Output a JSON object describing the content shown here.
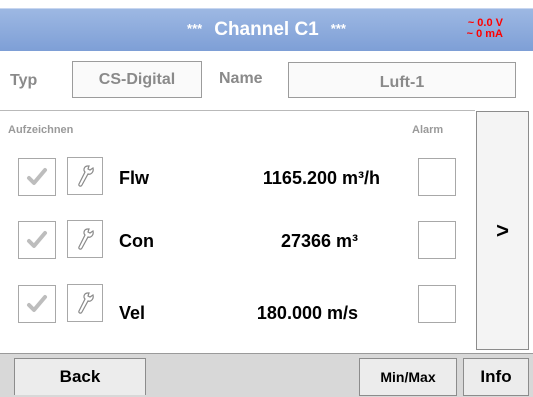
{
  "header": {
    "stars_left": "***",
    "title": "Channel C1",
    "stars_right": "***",
    "voltage": "~ 0.0 V",
    "current": "~ 0 mA"
  },
  "config": {
    "typ_label": "Typ",
    "typ_value": "CS-Digital",
    "name_label": "Name",
    "name_value": "Luft-1"
  },
  "list": {
    "record_label": "Aufzeichnen",
    "alarm_label": "Alarm",
    "rows": [
      {
        "name": "Flw",
        "value": "1165.200 m³/h",
        "recorded": true,
        "alarm": false
      },
      {
        "name": "Con",
        "value": "27366 m³",
        "recorded": true,
        "alarm": false
      },
      {
        "name": "Vel",
        "value": "180.000 m/s",
        "recorded": true,
        "alarm": false
      }
    ]
  },
  "nav": {
    "next_label": ">"
  },
  "footer": {
    "back_label": "Back",
    "minmax_label": "Min/Max",
    "info_label": "Info"
  },
  "icons": {
    "check": "checkmark-icon",
    "settings": "wrench-icon"
  },
  "colors": {
    "title_bar": "#8aa9dc",
    "readings": "#ff0000"
  }
}
